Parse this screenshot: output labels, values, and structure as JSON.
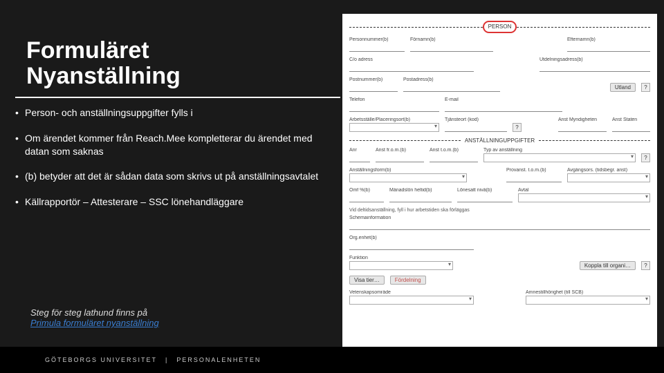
{
  "title_line1": "Formuläret",
  "title_line2": "Nyanställning",
  "bullets": [
    "Person- och anställningsuppgifter fylls i",
    "Om ärendet kommer från Reach.Mee kompletterar du ärendet med datan som saknas",
    "(b) betyder att det är sådan data som skrivs ut på anställningsavtalet",
    "Källrapportör – Attesterare – SSC lönehandläggare"
  ],
  "footnote_text": "Steg för steg lathund finns på",
  "footnote_link": "Primula formuläret nyanställning",
  "footer": {
    "left": "GÖTEBORGS UNIVERSITET",
    "sep": "|",
    "right": "PERSONALENHETEN"
  },
  "form": {
    "sections": {
      "person": "PERSON",
      "anst": "ANSTÄLLNINGUPPGIFTER"
    },
    "labels": {
      "personnr": "Personnummer(b)",
      "fornamn": "Förnamn(b)",
      "efternamn": "Efternamn(b)",
      "coadress": "C/o adress",
      "utdelning": "Utdelningsadress(b)",
      "postnr": "Postnummer(b)",
      "postadress": "Postadress(b)",
      "utland": "Utland",
      "telefon": "Telefon",
      "email": "E-mail",
      "arbetsplats": "Arbetsställe/Placeringsort(b)",
      "tjansteort": "Tjänsteort (kod)",
      "anstmynd": "Anst Myndigheten",
      "anststaten": "Anst Staten",
      "anr": "Anr",
      "anstfrom": "Anst fr.o.m.(b)",
      "ansttom": "Anst t.o.m.(b)",
      "typanst": "Typ av anställning",
      "anstform": "Anställningsform(b)",
      "provanst": "Provanst. t.o.m.(b)",
      "avgang": "Avgångsors. (tidsbegr. anst)",
      "omf": "Omf %(b)",
      "manadslon": "Månadslön heltid(b)",
      "lonesatt": "Lönesatt nivå(b)",
      "avtal": "Avtal",
      "deltid_note": "Vid deltidsanställning, fyll i hur arbetstiden ska förläggas",
      "schema": "Schemainformation",
      "orgenhet": "Org.enhet(b)",
      "funktion": "Funktion",
      "koppla": "Koppla till organi…",
      "visatier": "Visa tier…",
      "fordelning": "Fördelning",
      "vetenskap": "Vetenskapsområde",
      "amnes": "Ämnestillhörighet (till SCB)"
    },
    "q": "?"
  }
}
